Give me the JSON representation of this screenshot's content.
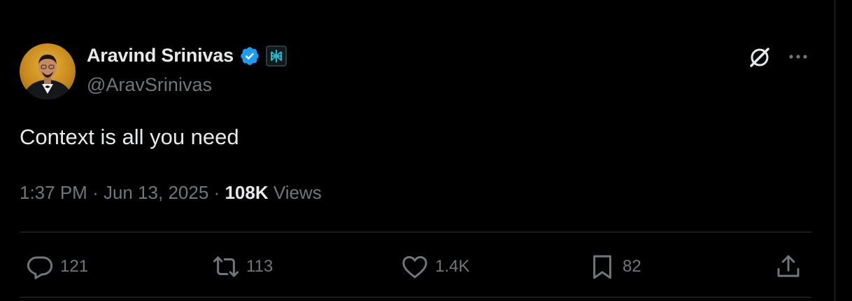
{
  "author": {
    "display_name": "Aravind Srinivas",
    "handle": "@AravSrinivas",
    "verified": true,
    "affiliate_badge_icon": "perplexity-logo-icon",
    "verified_color": "#1d9bf0"
  },
  "tweet": {
    "text": "Context is all you need",
    "time": "1:37 PM",
    "date": "Jun 13, 2025",
    "views_count": "108K",
    "views_label": "Views"
  },
  "actions": {
    "replies": "121",
    "reposts": "113",
    "likes": "1.4K",
    "bookmarks": "82"
  },
  "icons": {
    "grok": "grok-icon",
    "more": "more-options-icon",
    "reply": "reply-icon",
    "repost": "repost-icon",
    "like": "heart-icon",
    "bookmark": "bookmark-icon",
    "share": "share-icon"
  },
  "colors": {
    "background": "#000000",
    "text_primary": "#e7e9ea",
    "text_secondary": "#71767b",
    "divider": "#2f3336"
  }
}
